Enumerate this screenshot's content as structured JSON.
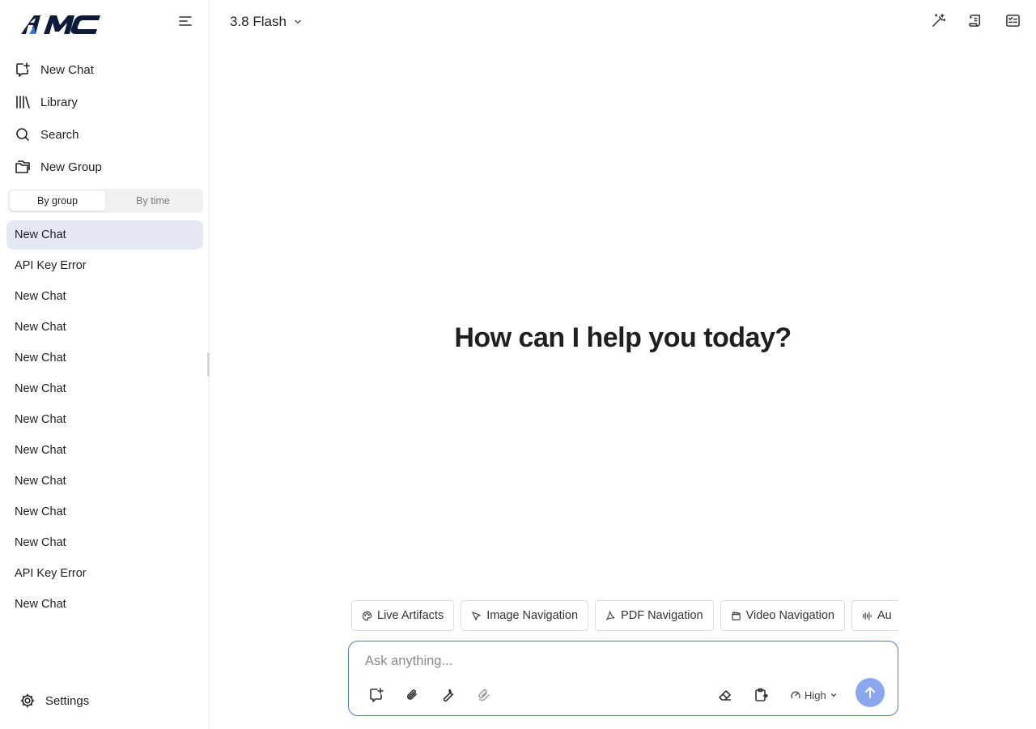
{
  "app": {
    "logo_text": "AMC",
    "model_name": "3.8 Flash",
    "greeting": "How can I help you today?"
  },
  "sidebar": {
    "nav": [
      {
        "label": "New Chat",
        "icon": "new-chat-icon"
      },
      {
        "label": "Library",
        "icon": "library-icon"
      },
      {
        "label": "Search",
        "icon": "search-icon"
      },
      {
        "label": "New Group",
        "icon": "new-group-icon"
      }
    ],
    "segment": {
      "by_group": "By group",
      "by_time": "By time",
      "active": "By group"
    },
    "chats": [
      "New Chat",
      "API Key Error",
      "New Chat",
      "New Chat",
      "New Chat",
      "New Chat",
      "New Chat",
      "New Chat",
      "New Chat",
      "New Chat",
      "New Chat",
      "API Key Error",
      "New Chat"
    ],
    "settings_label": "Settings"
  },
  "chips": [
    {
      "label": "Live Artifacts",
      "icon": "palette-icon"
    },
    {
      "label": "Image Navigation",
      "icon": "cursor-icon"
    },
    {
      "label": "PDF Navigation",
      "icon": "pdf-icon"
    },
    {
      "label": "Video Navigation",
      "icon": "clapperboard-icon"
    },
    {
      "label": "Au",
      "icon": "audio-wave-icon"
    }
  ],
  "composer": {
    "placeholder": "Ask anything...",
    "effort_label": "High"
  },
  "colors": {
    "accent": "#4a7bdc",
    "send_button": "#8aa8f0",
    "active_chat_bg": "#e5e9f6"
  }
}
